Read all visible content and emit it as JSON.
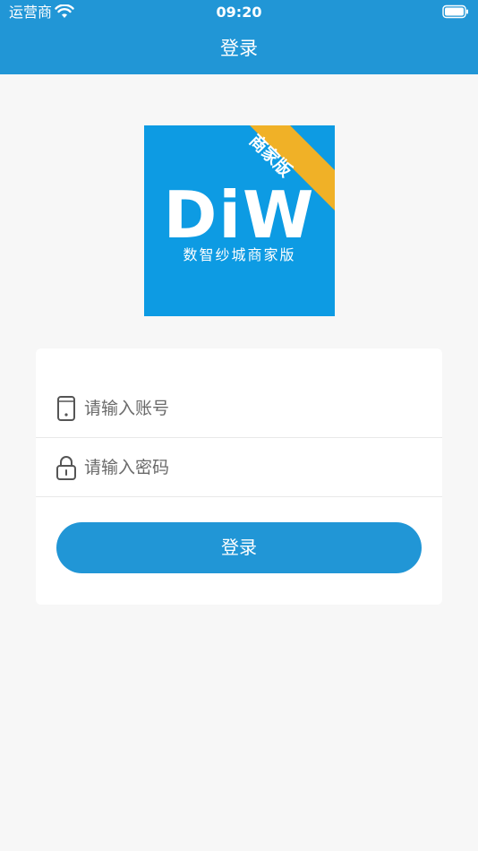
{
  "status_bar": {
    "carrier": "运营商",
    "time": "09:20"
  },
  "nav": {
    "title": "登录"
  },
  "logo": {
    "wordmark": "DiW",
    "subtitle": "数智纱城商家版",
    "ribbon": "商家版",
    "bg_color": "#0d9be3",
    "ribbon_color": "#f0b127"
  },
  "form": {
    "account_placeholder": "请输入账号",
    "account_value": "",
    "password_placeholder": "请输入密码",
    "password_value": "",
    "login_label": "登录"
  },
  "colors": {
    "primary": "#2196d6",
    "background": "#f7f7f7"
  },
  "icons": {
    "account": "phone-icon",
    "password": "lock-icon"
  }
}
